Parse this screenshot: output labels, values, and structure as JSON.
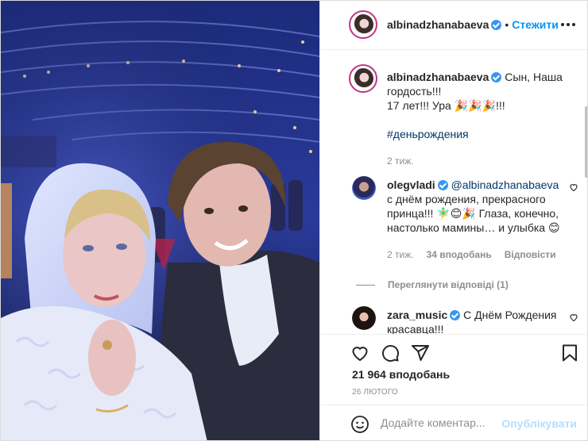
{
  "header": {
    "username": "albinadzhanabaeva",
    "separator": "•",
    "follow_label": "Стежити"
  },
  "caption": {
    "username": "albinadzhanabaeva",
    "line1": "Сын, Наша",
    "line2": "гордость!!!",
    "line3": "17 лет!!! Ура 🎉🎉🎉!!!",
    "hashtag": "#деньрождения",
    "time": "2 тиж."
  },
  "comments": [
    {
      "username": "olegvladi",
      "mention": "@albinadzhanabaeva",
      "text": "с днём рождения, прекрасного принца!!! 🧚‍♂️😊🎉 Глаза, конечно, настолько мамины… и улыбка 😊",
      "time": "2 тиж.",
      "likes": "34 вподобань",
      "reply_label": "Відповісти",
      "view_replies": "Переглянути відповіді (1)"
    },
    {
      "username": "zara_music",
      "text": "С Днём Рождения красавца!!!"
    }
  ],
  "stats": {
    "likes": "21 964 вподобань",
    "date": "26 ЛЮТОГО"
  },
  "add_comment": {
    "placeholder": "Додайте коментар...",
    "post_label": "Опублікувати"
  },
  "icons": {
    "more": "more-options-icon",
    "heart": "heart-icon",
    "comment": "comment-icon",
    "share": "share-icon",
    "save": "bookmark-icon",
    "emoji": "emoji-icon"
  },
  "colors": {
    "accent": "#0095f6",
    "link": "#00376b",
    "muted": "#8e8e8e",
    "verified": "#3897f0"
  }
}
